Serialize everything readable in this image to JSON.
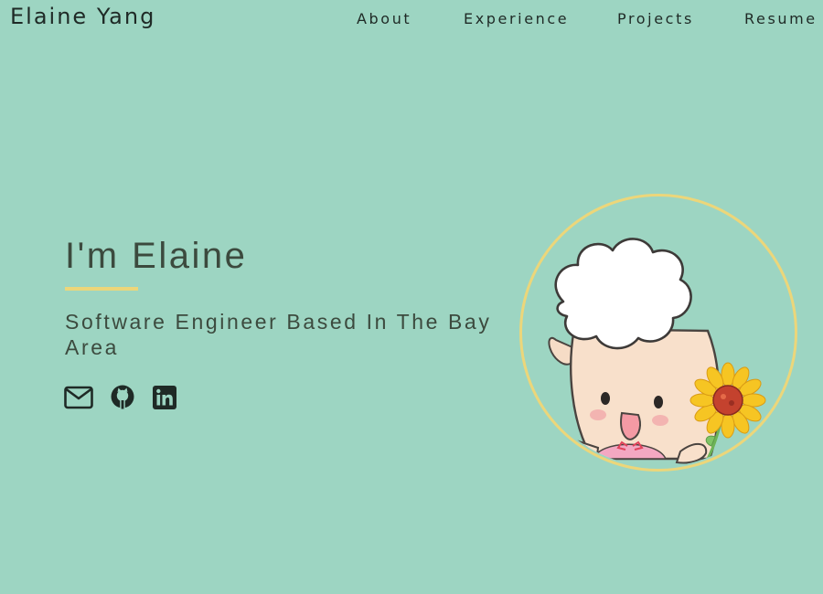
{
  "header": {
    "brand": "Elaine Yang",
    "nav": [
      {
        "label": "About"
      },
      {
        "label": "Experience"
      },
      {
        "label": "Projects"
      },
      {
        "label": "Resume"
      }
    ]
  },
  "hero": {
    "title": "I'm Elaine",
    "subtitle": "Software Engineer Based In The Bay Area",
    "socials": [
      {
        "icon": "mail-icon"
      },
      {
        "icon": "github-icon"
      },
      {
        "icon": "linkedin-icon"
      }
    ],
    "avatar": {
      "icon": "lamb-with-sunflower-illustration"
    }
  },
  "colors": {
    "background": "#9dd5c2",
    "accent": "#ecd67a",
    "text": "#3c4a3e",
    "nav_text": "#1f2a26"
  }
}
